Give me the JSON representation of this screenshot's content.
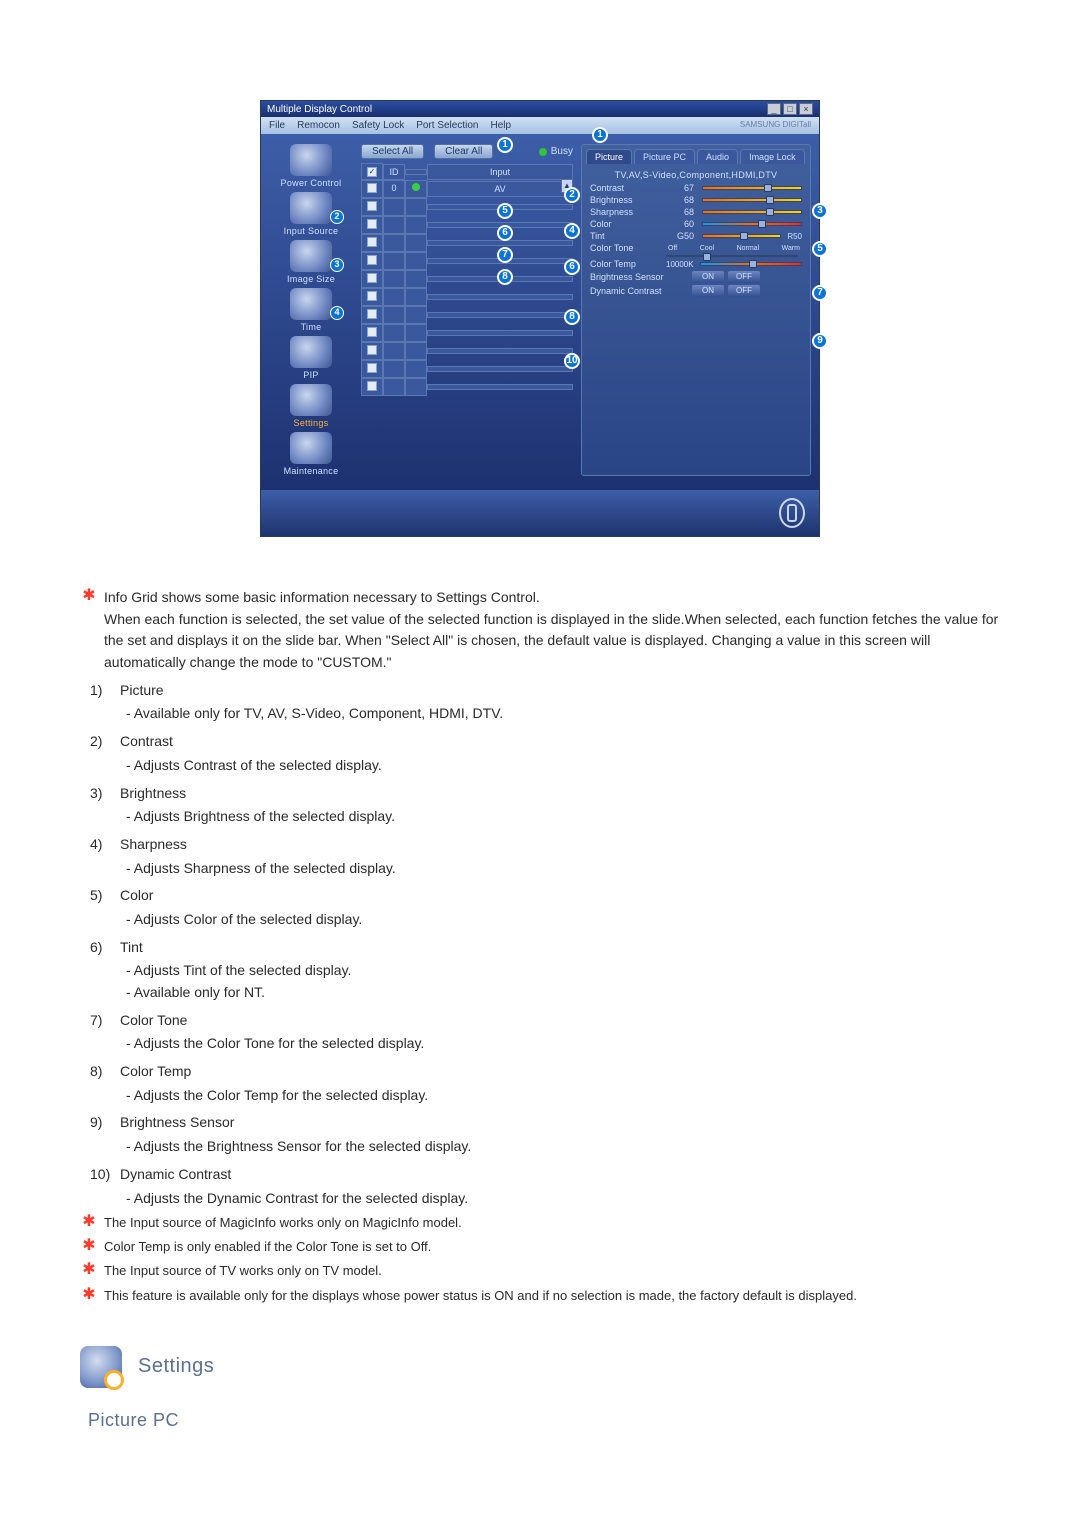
{
  "window": {
    "title": "Multiple Display Control",
    "ctrl_min": "_",
    "ctrl_max": "□",
    "ctrl_close": "×"
  },
  "menu": {
    "items": [
      "File",
      "Remocon",
      "Safety Lock",
      "Port Selection",
      "Help"
    ],
    "brand": "SAMSUNG DIGITall"
  },
  "sidebar": {
    "items": [
      {
        "label": "Power Control",
        "badge": ""
      },
      {
        "label": "Input Source",
        "badge": "2"
      },
      {
        "label": "Image Size",
        "badge": "3"
      },
      {
        "label": "Time",
        "badge": "4"
      },
      {
        "label": "PIP",
        "badge": ""
      },
      {
        "label": "Settings",
        "badge": ""
      },
      {
        "label": "Maintenance",
        "badge": ""
      }
    ]
  },
  "center": {
    "select_all": "Select All",
    "clear_all": "Clear All",
    "busy": "Busy",
    "head_id": "ID",
    "head_input": "Input",
    "row0_id": "0",
    "row0_input": "AV",
    "scroll_up": "▲",
    "callouts": {
      "c1": "1",
      "c5": "5",
      "c6": "6",
      "c7": "7",
      "c8": "8"
    }
  },
  "panel": {
    "tabs": [
      "Picture",
      "Picture PC",
      "Audio",
      "Image Lock"
    ],
    "subhead": "TV,AV,S-Video,Component,HDMI,DTV",
    "rows": {
      "contrast": {
        "label": "Contrast",
        "value": "67"
      },
      "brightness": {
        "label": "Brightness",
        "value": "68"
      },
      "sharpness": {
        "label": "Sharpness",
        "value": "68"
      },
      "color": {
        "label": "Color",
        "value": "60"
      },
      "tint": {
        "label": "Tint",
        "left": "G50",
        "right": "R50"
      },
      "color_tone": {
        "label": "Color Tone",
        "opts": [
          "Off",
          "Cool",
          "Normal",
          "Warm"
        ]
      },
      "color_temp": {
        "label": "Color Temp",
        "value": "10000K"
      },
      "bsensor": {
        "label": "Brightness Sensor",
        "on": "ON",
        "off": "OFF"
      },
      "dcontrast": {
        "label": "Dynamic Contrast",
        "on": "ON",
        "off": "OFF"
      }
    },
    "callouts": {
      "c1": "1",
      "c2": "2",
      "c3": "3",
      "c4": "4",
      "c5": "5",
      "c6": "6",
      "c7": "7",
      "c8": "8",
      "c9": "9",
      "c10": "10"
    }
  },
  "doc": {
    "intro": "Info Grid shows some basic information necessary to Settings Control.",
    "intro_body": "When each function is selected, the set value of the selected function is displayed in the slide.When selected, each function fetches the value for the set and displays it on the slide bar. When \"Select All\" is chosen, the default value is displayed. Changing a value in this screen will automatically change the mode to \"CUSTOM.\"",
    "items": [
      {
        "n": "1)",
        "t": "Picture",
        "d": [
          "- Available only for TV, AV, S-Video, Component, HDMI, DTV."
        ]
      },
      {
        "n": "2)",
        "t": "Contrast",
        "d": [
          "- Adjusts Contrast of the selected display."
        ]
      },
      {
        "n": "3)",
        "t": "Brightness",
        "d": [
          "- Adjusts Brightness of the selected display."
        ]
      },
      {
        "n": "4)",
        "t": "Sharpness",
        "d": [
          "- Adjusts Sharpness of the selected display."
        ]
      },
      {
        "n": "5)",
        "t": "Color",
        "d": [
          "- Adjusts Color of the selected display."
        ]
      },
      {
        "n": "6)",
        "t": "Tint",
        "d": [
          "- Adjusts Tint of the selected display.",
          "- Available  only for NT."
        ]
      },
      {
        "n": "7)",
        "t": "Color Tone",
        "d": [
          "- Adjusts the Color Tone for the selected display."
        ]
      },
      {
        "n": "8)",
        "t": "Color Temp",
        "d": [
          "- Adjusts the Color Temp for the selected display."
        ]
      },
      {
        "n": "9)",
        "t": "Brightness Sensor",
        "d": [
          "- Adjusts the Brightness Sensor for the selected display."
        ]
      },
      {
        "n": "10)",
        "t": "Dynamic Contrast",
        "d": [
          "- Adjusts the Dynamic Contrast for the selected display."
        ]
      }
    ],
    "notes": [
      "The Input source of MagicInfo works only on MagicInfo model.",
      "Color Temp is only enabled if the Color Tone is set to Off.",
      "The Input source of TV works only on TV model.",
      "This feature is available only for the displays whose power status is ON and if no selection is made, the factory default is displayed."
    ]
  },
  "section": {
    "title": "Settings",
    "sub": "Picture PC"
  },
  "glyphs": {
    "star": "✱"
  }
}
